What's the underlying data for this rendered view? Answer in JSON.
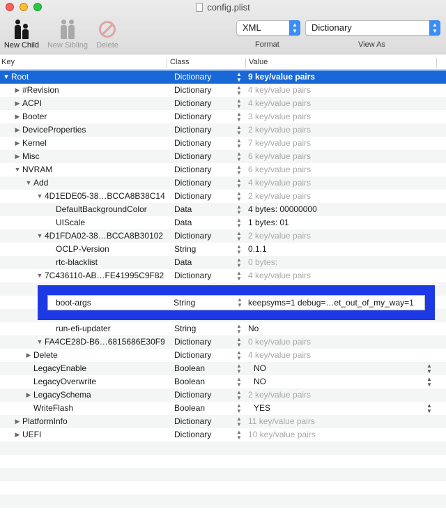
{
  "window": {
    "title": "config.plist"
  },
  "toolbar": {
    "new_child": "New Child",
    "new_sibling": "New Sibling",
    "delete": "Delete",
    "format_value": "XML",
    "format_label": "Format",
    "view_as_value": "Dictionary",
    "view_as_label": "View As"
  },
  "columns": {
    "key": "Key",
    "class": "Class",
    "value": "Value"
  },
  "rows": [
    {
      "key": "Root",
      "cls": "Dictionary",
      "val": "9 key/value pairs"
    },
    {
      "key": "#Revision",
      "cls": "Dictionary",
      "val": "4 key/value pairs"
    },
    {
      "key": "ACPI",
      "cls": "Dictionary",
      "val": "4 key/value pairs"
    },
    {
      "key": "Booter",
      "cls": "Dictionary",
      "val": "3 key/value pairs"
    },
    {
      "key": "DeviceProperties",
      "cls": "Dictionary",
      "val": "2 key/value pairs"
    },
    {
      "key": "Kernel",
      "cls": "Dictionary",
      "val": "7 key/value pairs"
    },
    {
      "key": "Misc",
      "cls": "Dictionary",
      "val": "6 key/value pairs"
    },
    {
      "key": "NVRAM",
      "cls": "Dictionary",
      "val": "6 key/value pairs"
    },
    {
      "key": "Add",
      "cls": "Dictionary",
      "val": "4 key/value pairs"
    },
    {
      "key": "4D1EDE05-38…BCCA8B38C14",
      "cls": "Dictionary",
      "val": "2 key/value pairs"
    },
    {
      "key": "DefaultBackgroundColor",
      "cls": "Data",
      "val": "4 bytes: 00000000"
    },
    {
      "key": "UIScale",
      "cls": "Data",
      "val": "1 bytes: 01"
    },
    {
      "key": "4D1FDA02-38…BCCA8B30102",
      "cls": "Dictionary",
      "val": "2 key/value pairs"
    },
    {
      "key": "OCLP-Version",
      "cls": "String",
      "val": "0.1.1"
    },
    {
      "key": "rtc-blacklist",
      "cls": "Data",
      "val": "0 bytes:"
    },
    {
      "key": "7C436110-AB…FE41995C9F82",
      "cls": "Dictionary",
      "val": "4 key/value pairs"
    },
    {
      "key": "run-efi-updater",
      "cls": "String",
      "val": "No"
    },
    {
      "key": "FA4CE28D-B6…6815686E30F9",
      "cls": "Dictionary",
      "val": "0 key/value pairs"
    },
    {
      "key": "Delete",
      "cls": "Dictionary",
      "val": "4 key/value pairs"
    },
    {
      "key": "LegacyEnable",
      "cls": "Boolean",
      "val": "NO"
    },
    {
      "key": "LegacyOverwrite",
      "cls": "Boolean",
      "val": "NO"
    },
    {
      "key": "LegacySchema",
      "cls": "Dictionary",
      "val": "2 key/value pairs"
    },
    {
      "key": "WriteFlash",
      "cls": "Boolean",
      "val": "YES"
    },
    {
      "key": "PlatformInfo",
      "cls": "Dictionary",
      "val": "11 key/value pairs"
    },
    {
      "key": "UEFI",
      "cls": "Dictionary",
      "val": "10 key/value pairs"
    }
  ],
  "editing": {
    "key": "boot-args",
    "cls": "String",
    "val": "keepsyms=1 debug=…et_out_of_my_way=1"
  },
  "colors": {
    "selection": "#1968d7",
    "edit_highlight": "#1d39e6",
    "popup_accent": "#3b8df5"
  },
  "icons": {
    "new_child": "two-people-icon",
    "new_sibling": "two-people-icon",
    "delete": "no-entry-icon",
    "collapsed": "disclosure-right-icon",
    "expanded": "disclosure-down-icon"
  }
}
